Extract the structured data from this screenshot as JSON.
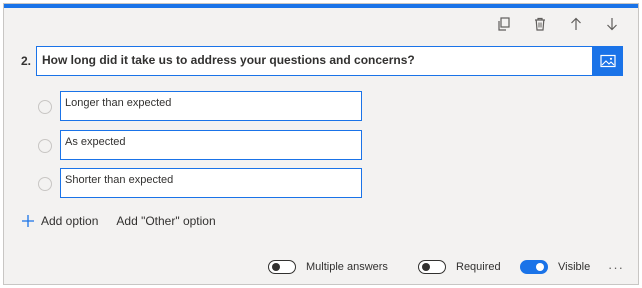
{
  "colors": {
    "accent": "#1a73e8",
    "card_bg": "#f3f2f1",
    "text": "#323130"
  },
  "toolbar": {
    "icons": [
      "copy-icon",
      "delete-icon",
      "arrow-up-icon",
      "arrow-down-icon"
    ]
  },
  "question": {
    "number": "2.",
    "text": "How long did it take us to address your questions and concerns?",
    "image_icon": "image-icon"
  },
  "options": [
    {
      "label": "Longer than expected"
    },
    {
      "label": "As expected"
    },
    {
      "label": "Shorter than expected"
    }
  ],
  "actions": {
    "add_option": "Add option",
    "add_other": "Add \"Other\" option"
  },
  "footer": {
    "multiple_answers": {
      "label": "Multiple answers",
      "on": false
    },
    "required": {
      "label": "Required",
      "on": false
    },
    "visible": {
      "label": "Visible",
      "on": true
    },
    "more": "···"
  }
}
